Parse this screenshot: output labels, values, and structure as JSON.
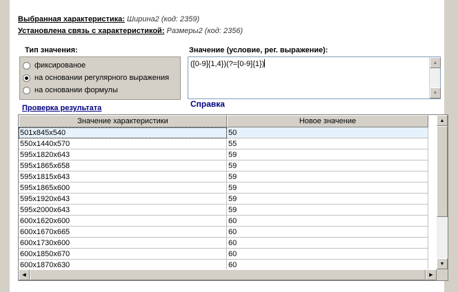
{
  "header": {
    "selected_label": "Выбранная характеристика:",
    "selected_value": "Ширина2 (код: 2359)",
    "link_label": "Установлена связь с характеристикой:",
    "link_value": "Размеры2 (код: 2356)"
  },
  "value_type": {
    "title": "Тип значения:",
    "options": [
      "фиксированое",
      "на основании регулярного выражения",
      "на основании формулы"
    ],
    "selected_index": 1
  },
  "expression": {
    "label": "Значение (условие, рег. выражение):",
    "value": "([0-9]{1,4})(?=[0-9]{1})"
  },
  "help_link": "Справка",
  "check_label": "Проверка результата",
  "table": {
    "columns": [
      "Значение характеристики",
      "Новое значение"
    ],
    "rows": [
      [
        "501x845x540",
        "50"
      ],
      [
        "550x1440x570",
        "55"
      ],
      [
        "595x1820x643",
        "59"
      ],
      [
        "595x1865x658",
        "59"
      ],
      [
        "595x1815x643",
        "59"
      ],
      [
        "595x1865x600",
        "59"
      ],
      [
        "595x1920x643",
        "59"
      ],
      [
        "595x2000x643",
        "59"
      ],
      [
        "600x1620x600",
        "60"
      ],
      [
        "600x1670x665",
        "60"
      ],
      [
        "600x1730x600",
        "60"
      ],
      [
        "600x1850x670",
        "60"
      ],
      [
        "600x1870x630",
        "60"
      ]
    ],
    "selected_row": 0
  }
}
